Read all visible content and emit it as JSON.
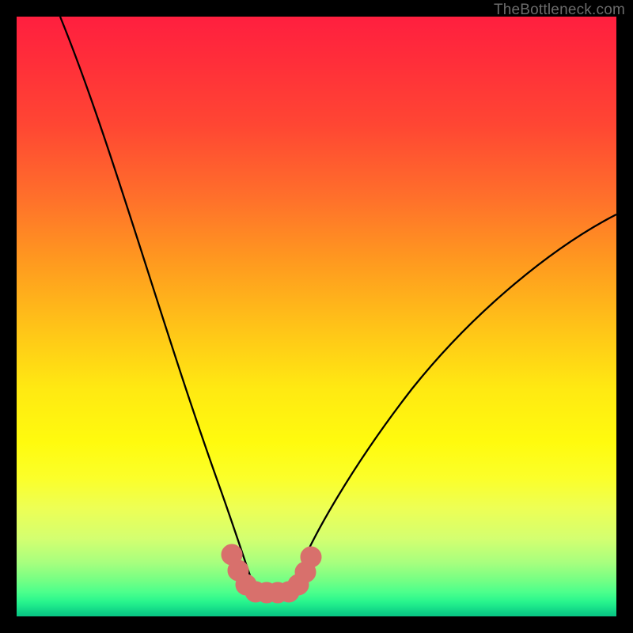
{
  "watermark": "TheBottleneck.com",
  "colors": {
    "page_bg": "#000000",
    "curve": "#000000",
    "marker": "#d8706c"
  },
  "chart_data": {
    "type": "line",
    "title": "",
    "xlabel": "",
    "ylabel": "",
    "xlim": [
      0,
      100
    ],
    "ylim": [
      0,
      100
    ],
    "grid": false,
    "series": [
      {
        "name": "bottleneck-curve",
        "x": [
          0,
          3,
          6,
          9,
          12,
          15,
          18,
          21,
          24,
          27,
          30,
          33,
          35,
          37,
          39,
          40,
          41,
          42,
          44,
          46,
          48,
          50,
          52,
          55,
          58,
          62,
          66,
          70,
          75,
          80,
          85,
          90,
          95,
          100
        ],
        "y": [
          100,
          94,
          88,
          82,
          75,
          68,
          61,
          53,
          45,
          37,
          29,
          21,
          15,
          10,
          6,
          4,
          3,
          3,
          3,
          4,
          6,
          9,
          12,
          17,
          22,
          28,
          34,
          40,
          47,
          53,
          59,
          64,
          68,
          72
        ]
      }
    ],
    "markers": {
      "name": "highlight-band",
      "x": [
        35,
        36,
        37,
        38,
        39,
        40,
        41,
        42,
        43,
        44,
        45,
        46
      ],
      "y": [
        15,
        11,
        8,
        6,
        4,
        3,
        3,
        3,
        3,
        4,
        5,
        7
      ]
    }
  }
}
